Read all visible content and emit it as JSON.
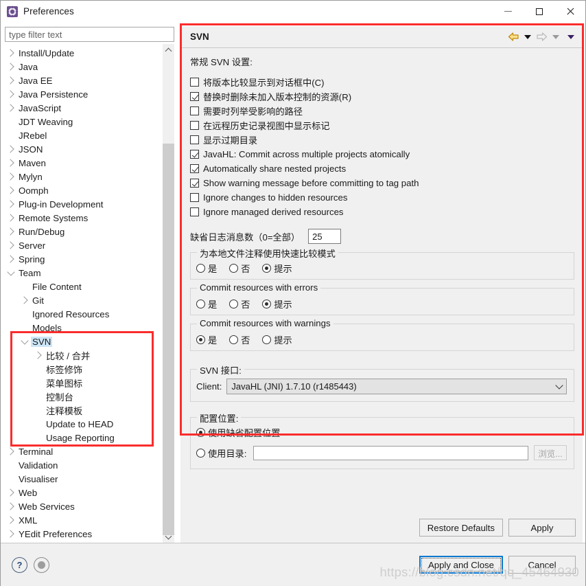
{
  "window": {
    "title": "Preferences",
    "icon": "gear-icon",
    "buttons": {
      "minimize": "minimize-icon",
      "maximize": "maximize-icon",
      "close": "close-icon"
    }
  },
  "sidebar": {
    "filter_placeholder": "type filter text",
    "filter_value": "",
    "items": [
      {
        "label": "Install/Update",
        "indent": 0,
        "twisty": "right"
      },
      {
        "label": "Java",
        "indent": 0,
        "twisty": "right"
      },
      {
        "label": "Java EE",
        "indent": 0,
        "twisty": "right"
      },
      {
        "label": "Java Persistence",
        "indent": 0,
        "twisty": "right"
      },
      {
        "label": "JavaScript",
        "indent": 0,
        "twisty": "right"
      },
      {
        "label": "JDT Weaving",
        "indent": 0,
        "twisty": "none"
      },
      {
        "label": "JRebel",
        "indent": 0,
        "twisty": "none"
      },
      {
        "label": "JSON",
        "indent": 0,
        "twisty": "right"
      },
      {
        "label": "Maven",
        "indent": 0,
        "twisty": "right"
      },
      {
        "label": "Mylyn",
        "indent": 0,
        "twisty": "right"
      },
      {
        "label": "Oomph",
        "indent": 0,
        "twisty": "right"
      },
      {
        "label": "Plug-in Development",
        "indent": 0,
        "twisty": "right"
      },
      {
        "label": "Remote Systems",
        "indent": 0,
        "twisty": "right"
      },
      {
        "label": "Run/Debug",
        "indent": 0,
        "twisty": "right"
      },
      {
        "label": "Server",
        "indent": 0,
        "twisty": "right"
      },
      {
        "label": "Spring",
        "indent": 0,
        "twisty": "right"
      },
      {
        "label": "Team",
        "indent": 0,
        "twisty": "down"
      },
      {
        "label": "File Content",
        "indent": 1,
        "twisty": "none"
      },
      {
        "label": "Git",
        "indent": 1,
        "twisty": "right"
      },
      {
        "label": "Ignored Resources",
        "indent": 1,
        "twisty": "none"
      },
      {
        "label": "Models",
        "indent": 1,
        "twisty": "none"
      },
      {
        "label": "SVN",
        "indent": 1,
        "twisty": "down",
        "selected": true
      },
      {
        "label": "比较 / 合并",
        "indent": 2,
        "twisty": "right"
      },
      {
        "label": "标签修饰",
        "indent": 2,
        "twisty": "none"
      },
      {
        "label": "菜单图标",
        "indent": 2,
        "twisty": "none"
      },
      {
        "label": "控制台",
        "indent": 2,
        "twisty": "none"
      },
      {
        "label": "注释模板",
        "indent": 2,
        "twisty": "none"
      },
      {
        "label": "Update to HEAD",
        "indent": 2,
        "twisty": "none"
      },
      {
        "label": "Usage Reporting",
        "indent": 2,
        "twisty": "none"
      },
      {
        "label": "Terminal",
        "indent": 0,
        "twisty": "right"
      },
      {
        "label": "Validation",
        "indent": 0,
        "twisty": "none"
      },
      {
        "label": "Visualiser",
        "indent": 0,
        "twisty": "none"
      },
      {
        "label": "Web",
        "indent": 0,
        "twisty": "right"
      },
      {
        "label": "Web Services",
        "indent": 0,
        "twisty": "right"
      },
      {
        "label": "XML",
        "indent": 0,
        "twisty": "right"
      },
      {
        "label": "YEdit Preferences",
        "indent": 0,
        "twisty": "right"
      }
    ]
  },
  "page": {
    "title": "SVN",
    "nav": {
      "back": "back-arrow-icon",
      "back_dropdown": "chevron-down-icon",
      "forward": "forward-arrow-icon",
      "forward_dropdown": "chevron-down-icon",
      "menu": "chevron-down-icon"
    },
    "section_title": "常规 SVN 设置:",
    "checkboxes": [
      {
        "label": "将版本比较显示到对话框中(C)",
        "checked": false
      },
      {
        "label": "替换时删除未加入版本控制的资源(R)",
        "checked": true
      },
      {
        "label": "需要时列举受影响的路径",
        "checked": false
      },
      {
        "label": "在远程历史记录视图中显示标记",
        "checked": false
      },
      {
        "label": "显示过期目录",
        "checked": false
      },
      {
        "label": "JavaHL: Commit across multiple projects atomically",
        "checked": true
      },
      {
        "label": "Automatically share nested projects",
        "checked": true
      },
      {
        "label": "Show warning message before committing to tag path",
        "checked": true
      },
      {
        "label": "Ignore changes to hidden resources",
        "checked": false
      },
      {
        "label": "Ignore managed derived resources",
        "checked": false
      }
    ],
    "log_messages": {
      "label": "缺省日志消息数（0=全部）",
      "value": "25"
    },
    "radio_groups": [
      {
        "title": "为本地文件注释使用快速比较模式",
        "options": [
          {
            "label": "是",
            "selected": false
          },
          {
            "label": "否",
            "selected": false
          },
          {
            "label": "提示",
            "selected": true
          }
        ]
      },
      {
        "title": "Commit resources with errors",
        "options": [
          {
            "label": "是",
            "selected": false
          },
          {
            "label": "否",
            "selected": false
          },
          {
            "label": "提示",
            "selected": true
          }
        ]
      },
      {
        "title": "Commit resources with warnings",
        "options": [
          {
            "label": "是",
            "selected": true
          },
          {
            "label": "否",
            "selected": false
          },
          {
            "label": "提示",
            "selected": false
          }
        ]
      }
    ],
    "svn_interface": {
      "title": "SVN 接口:",
      "client_label": "Client:",
      "client_value": "JavaHL (JNI) 1.7.10 (r1485443)"
    },
    "config_location": {
      "title": "配置位置:",
      "default_label": "使用缺省配置位置",
      "default_selected": true,
      "directory_label": "使用目录:",
      "directory_selected": false,
      "directory_value": "",
      "browse_label": "浏览..."
    },
    "restore_defaults_label": "Restore Defaults",
    "apply_label": "Apply"
  },
  "footer": {
    "help_icon": "help-icon",
    "help_glyph": "?",
    "secondary_icon": "oomph-recorder-icon",
    "apply_and_close_label": "Apply and Close",
    "cancel_label": "Cancel"
  },
  "annotations": {
    "watermark": "https://blog.csdn.net/qq_45464930",
    "highlight_color": "#fa2c2c"
  }
}
